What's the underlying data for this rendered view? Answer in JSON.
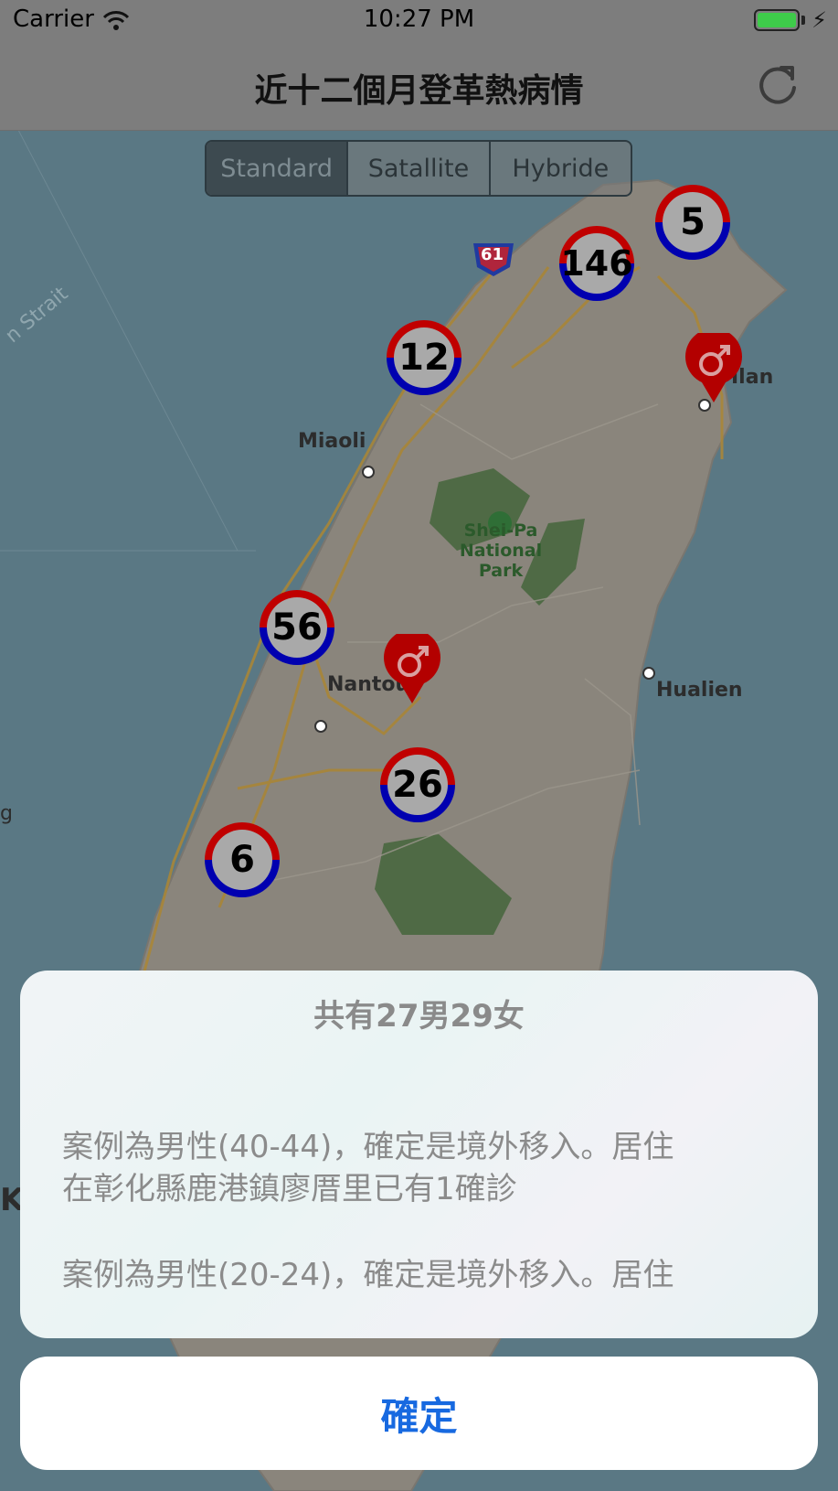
{
  "status_bar": {
    "carrier": "Carrier",
    "time": "10:27 PM"
  },
  "nav": {
    "title": "近十二個月登革熱病情",
    "refresh_icon": "refresh-icon"
  },
  "map_type": {
    "options": [
      "Standard",
      "Satallite",
      "Hybride"
    ],
    "selected": "Standard"
  },
  "map": {
    "labels": {
      "strait": "n Strait",
      "miaoli": "Miaoli",
      "park": "Shei-Pa\nNational Park",
      "nantou": "Nantou",
      "hualien": "Hualien",
      "yilan": "Ilan",
      "route": "61",
      "left_edge_g": "g",
      "left_edge_k": "K"
    },
    "clusters": [
      {
        "count": "5"
      },
      {
        "count": "146"
      },
      {
        "count": "12"
      },
      {
        "count": "56"
      },
      {
        "count": "26"
      },
      {
        "count": "6"
      }
    ],
    "pins": [
      {
        "icon": "male-symbol-icon"
      },
      {
        "icon": "male-symbol-icon"
      }
    ]
  },
  "alert": {
    "title": "共有27男29女",
    "messages": [
      "案例為男性(40-44)，確定是境外移入。居住\n在彰化縣鹿港鎮廖厝里已有1確診",
      "案例為男性(20-24)，確定是境外移入。居住"
    ],
    "ok_label": "確定"
  },
  "colors": {
    "accent": "#1769e0",
    "cluster_blue": "#0000b0",
    "cluster_red": "#c00000",
    "pin_red": "#b30000"
  }
}
